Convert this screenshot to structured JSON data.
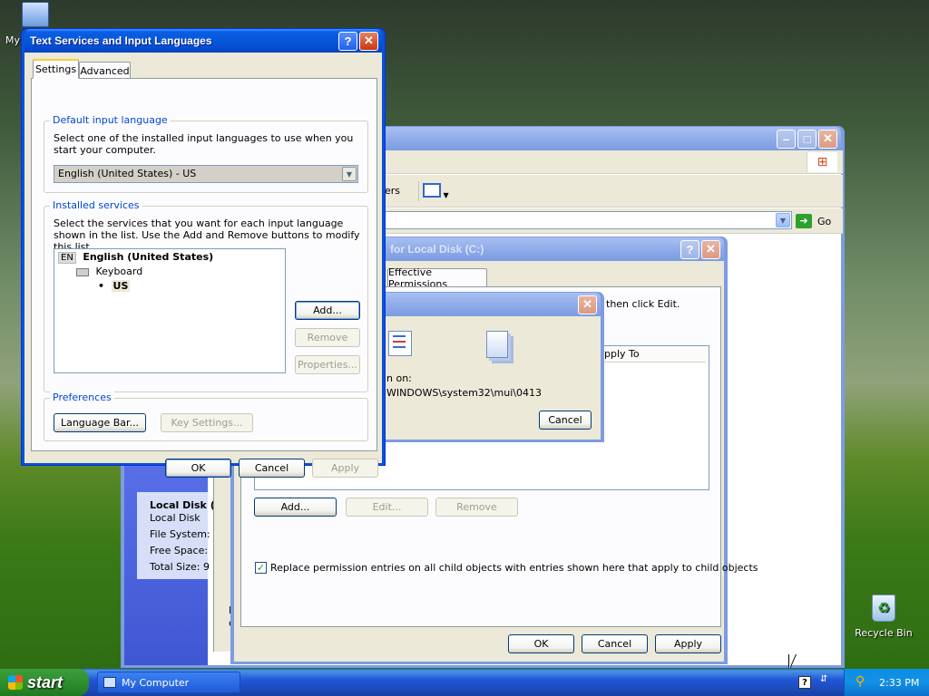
{
  "desktop": {
    "my_computer_label": "My",
    "recycle_bin_label": "Recycle Bin"
  },
  "explorer": {
    "toolbar_partial": "ers",
    "go_label": "Go",
    "details": {
      "title": "Local Disk (",
      "subtitle": "Local Disk",
      "file_system": "File System:",
      "free_space": "Free Space:",
      "total_size": "Total Size: 9",
      "partial_f": "F",
      "partial_c": "c"
    }
  },
  "advanced_security": {
    "title": "for Local Disk (C:)",
    "tab_effective": "Effective Permissions",
    "instruction": "then click Edit.",
    "column_apply_to": "pply To",
    "add_label": "Add...",
    "edit_label": "Edit...",
    "remove_label": "Remove",
    "replace_label": "Replace permission entries on all child objects with entries shown here that apply to child objects",
    "replace_checked": true,
    "ok_label": "OK",
    "cancel_label": "Cancel",
    "apply_label": "Apply"
  },
  "copy_dialog": {
    "from_label": "n on:",
    "path": "WINDOWS\\system32\\mui\\0413",
    "cancel_label": "Cancel"
  },
  "text_services": {
    "title": "Text Services and Input Languages",
    "tabs": [
      {
        "label": "Settings"
      },
      {
        "label": "Advanced"
      }
    ],
    "default_lang": {
      "legend": "Default input language",
      "description": "Select one of the installed input languages to use when you start your computer.",
      "selected": "English (United States) - US"
    },
    "installed": {
      "legend": "Installed services",
      "description": "Select the services that you want for each input language shown in the list. Use the Add and Remove buttons to modify this list.",
      "lang_code": "EN",
      "lang_name": "English (United States)",
      "category": "Keyboard",
      "layout": "US",
      "add_label": "Add...",
      "remove_label": "Remove",
      "properties_label": "Properties..."
    },
    "preferences": {
      "legend": "Preferences",
      "language_bar_label": "Language Bar...",
      "key_settings_label": "Key Settings..."
    },
    "ok_label": "OK",
    "cancel_label": "Cancel",
    "apply_label": "Apply"
  },
  "taskbar": {
    "start_label": "start",
    "task_my_computer": "My Computer",
    "clock": "2:33 PM"
  }
}
